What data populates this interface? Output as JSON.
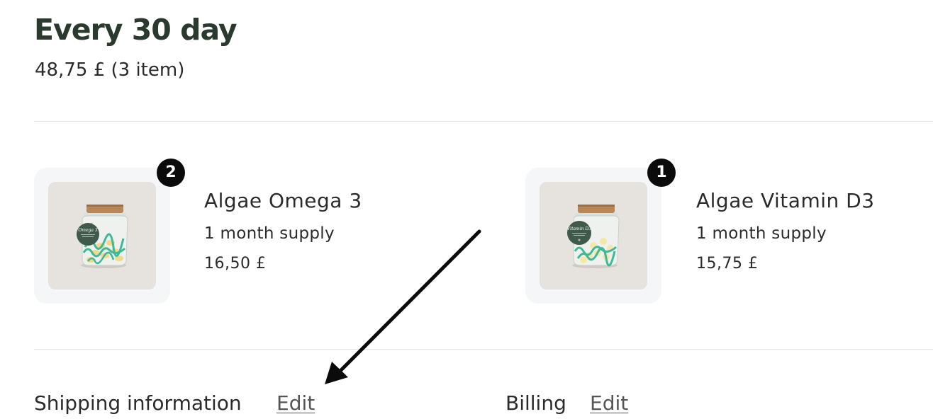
{
  "subscription": {
    "title": "Every 30 day",
    "summary": "48,75 £ (3 item)"
  },
  "products": [
    {
      "name": "Algae Omega 3",
      "supply": "1 month supply",
      "price": "16,50 £",
      "quantity": "2",
      "label_text": "Omega 3"
    },
    {
      "name": "Algae Vitamin D3",
      "supply": "1 month supply",
      "price": "15,75 £",
      "quantity": "1",
      "label_text": "Vitamin D3"
    }
  ],
  "shipping": {
    "label": "Shipping information",
    "edit_label": "Edit"
  },
  "billing": {
    "label": "Billing",
    "edit_label": "Edit"
  },
  "colors": {
    "title": "#2a3a2c",
    "badge": "#0b0b0b",
    "jar_label": "#3f5a4a",
    "algae": "#3db89a",
    "capsules": "#f2d98a",
    "cork": "#b5875a"
  },
  "icons": {
    "annotation": "arrow-icon"
  }
}
